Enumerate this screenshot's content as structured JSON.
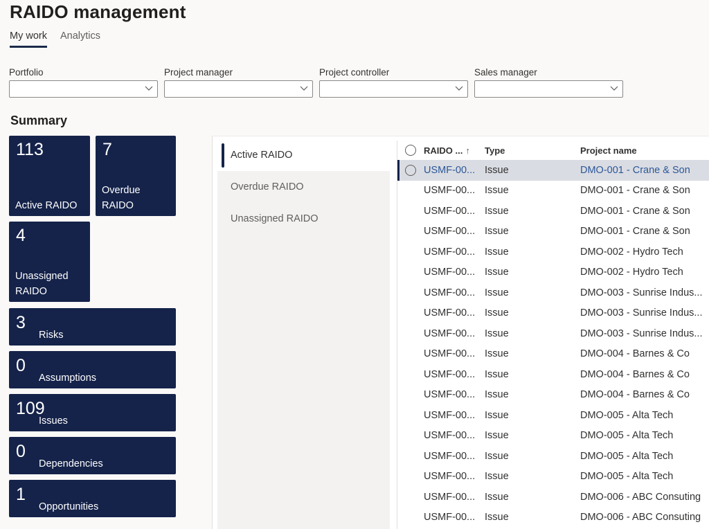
{
  "header": {
    "title": "RAIDO management",
    "tabs": [
      {
        "label": "My work",
        "active": true
      },
      {
        "label": "Analytics",
        "active": false
      }
    ]
  },
  "filters": [
    {
      "label": "Portfolio",
      "value": ""
    },
    {
      "label": "Project manager",
      "value": ""
    },
    {
      "label": "Project controller",
      "value": ""
    },
    {
      "label": "Sales manager",
      "value": ""
    }
  ],
  "summary": {
    "title": "Summary",
    "tiles": [
      {
        "value": "113",
        "label": "Active RAIDO"
      },
      {
        "value": "7",
        "label_line1": "Overdue",
        "label_line2": "RAIDO"
      },
      {
        "value": "4",
        "label_line1": "Unassigned",
        "label_line2": "RAIDO"
      },
      {
        "value": "3",
        "label": "Risks"
      },
      {
        "value": "0",
        "label": "Assumptions"
      },
      {
        "value": "109",
        "label": "Issues"
      },
      {
        "value": "0",
        "label": "Dependencies"
      },
      {
        "value": "1",
        "label": "Opportunities"
      }
    ],
    "tile_color": "#15234a"
  },
  "views": [
    {
      "label": "Active RAIDO",
      "active": true
    },
    {
      "label": "Overdue RAIDO",
      "active": false
    },
    {
      "label": "Unassigned RAIDO",
      "active": false
    }
  ],
  "grid": {
    "columns": {
      "id": "RAIDO ...",
      "sort_icon": "↑",
      "type": "Type",
      "project": "Project name"
    },
    "rows": [
      {
        "id": "USMF-00...",
        "type": "Issue",
        "project": "DMO-001 - Crane & Son",
        "selected": true
      },
      {
        "id": "USMF-00...",
        "type": "Issue",
        "project": "DMO-001 - Crane & Son"
      },
      {
        "id": "USMF-00...",
        "type": "Issue",
        "project": "DMO-001 - Crane & Son"
      },
      {
        "id": "USMF-00...",
        "type": "Issue",
        "project": "DMO-001 - Crane & Son"
      },
      {
        "id": "USMF-00...",
        "type": "Issue",
        "project": "DMO-002 - Hydro Tech"
      },
      {
        "id": "USMF-00...",
        "type": "Issue",
        "project": "DMO-002 - Hydro Tech"
      },
      {
        "id": "USMF-00...",
        "type": "Issue",
        "project": "DMO-003 - Sunrise Indus..."
      },
      {
        "id": "USMF-00...",
        "type": "Issue",
        "project": "DMO-003 - Sunrise Indus..."
      },
      {
        "id": "USMF-00...",
        "type": "Issue",
        "project": "DMO-003 - Sunrise Indus..."
      },
      {
        "id": "USMF-00...",
        "type": "Issue",
        "project": "DMO-004 - Barnes & Co"
      },
      {
        "id": "USMF-00...",
        "type": "Issue",
        "project": "DMO-004 - Barnes & Co"
      },
      {
        "id": "USMF-00...",
        "type": "Issue",
        "project": "DMO-004 - Barnes & Co"
      },
      {
        "id": "USMF-00...",
        "type": "Issue",
        "project": "DMO-005 - Alta Tech"
      },
      {
        "id": "USMF-00...",
        "type": "Issue",
        "project": "DMO-005 - Alta Tech"
      },
      {
        "id": "USMF-00...",
        "type": "Issue",
        "project": "DMO-005 - Alta Tech"
      },
      {
        "id": "USMF-00...",
        "type": "Issue",
        "project": "DMO-005 - Alta Tech"
      },
      {
        "id": "USMF-00...",
        "type": "Issue",
        "project": "DMO-006 - ABC Consuting"
      },
      {
        "id": "USMF-00...",
        "type": "Issue",
        "project": "DMO-006 - ABC Consuting"
      }
    ]
  }
}
